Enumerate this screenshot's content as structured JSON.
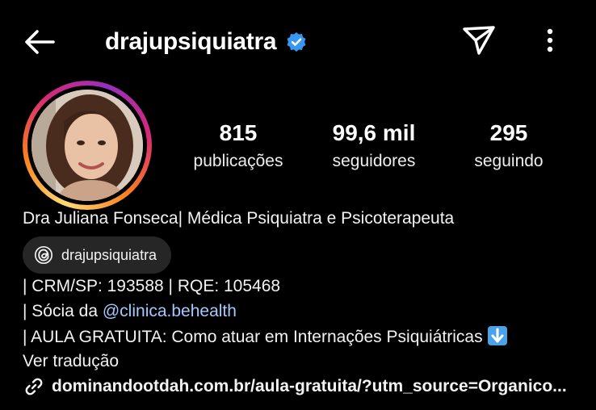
{
  "header": {
    "username": "drajupsiquiatra",
    "back_icon": "arrow-left-icon",
    "verified_icon": "verified-badge-icon",
    "send_icon": "paper-plane-icon",
    "more_icon": "more-vertical-icon"
  },
  "stats": [
    {
      "value": "815",
      "label": "publicações"
    },
    {
      "value": "99,6 mil",
      "label": "seguidores"
    },
    {
      "value": "295",
      "label": "seguindo"
    }
  ],
  "bio": {
    "name_line": "Dra Juliana Fonseca| Médica Psiquiatra e Psicoterapeuta",
    "threads_handle": "drajupsiquiatra",
    "line1": "| CRM/SP: 193588 | RQE: 105468",
    "line2_prefix": "| Sócia da ",
    "line2_mention": "@clinica.behealth",
    "line3": "| AULA GRATUITA: Como atuar em Internações Psiquiátricas",
    "line3_emoji": "down-arrow-emoji",
    "see_translation": "Ver tradução",
    "link": "dominandootdah.com.br/aula-gratuita/?utm_source=Organico..."
  },
  "colors": {
    "background": "#000000",
    "verified_blue": "#3897f0",
    "mention": "#a3c9ff",
    "chip_bg": "#262626"
  }
}
